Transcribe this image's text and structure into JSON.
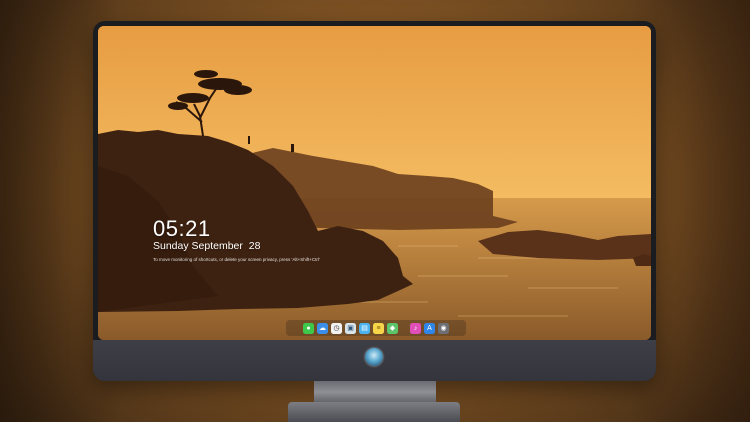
{
  "lockscreen": {
    "time": "05:21",
    "date": "Sunday September  28",
    "hint": "To move monitoring of shortcuts, or delete your screen privacy, press 'Alt+Shift+Ctrl'"
  },
  "dock": {
    "items": [
      {
        "name": "messages-icon",
        "color": "#3ec84b",
        "glyph": "●"
      },
      {
        "name": "weather-icon",
        "color": "#3b8fe8",
        "glyph": "☁"
      },
      {
        "name": "clock-icon",
        "color": "#f2f2f2",
        "glyph": "◷"
      },
      {
        "name": "photos-icon",
        "color": "#d8e3ea",
        "glyph": "▣"
      },
      {
        "name": "finder-icon",
        "color": "#4ab3f0",
        "glyph": "▤"
      },
      {
        "name": "notes-icon",
        "color": "#f7d54a",
        "glyph": "≡"
      },
      {
        "name": "maps-icon",
        "color": "#5cc46a",
        "glyph": "◆"
      },
      {
        "name": "music-icon",
        "color": "#e04fb7",
        "glyph": "♪"
      },
      {
        "name": "app-store-icon",
        "color": "#2f86e8",
        "glyph": "A"
      },
      {
        "name": "camera-icon",
        "color": "#6d6f75",
        "glyph": "◉"
      }
    ]
  },
  "colors": {
    "sky": "#f0b358",
    "bezel": "#1b1c20",
    "stand": "#7c7e84"
  }
}
